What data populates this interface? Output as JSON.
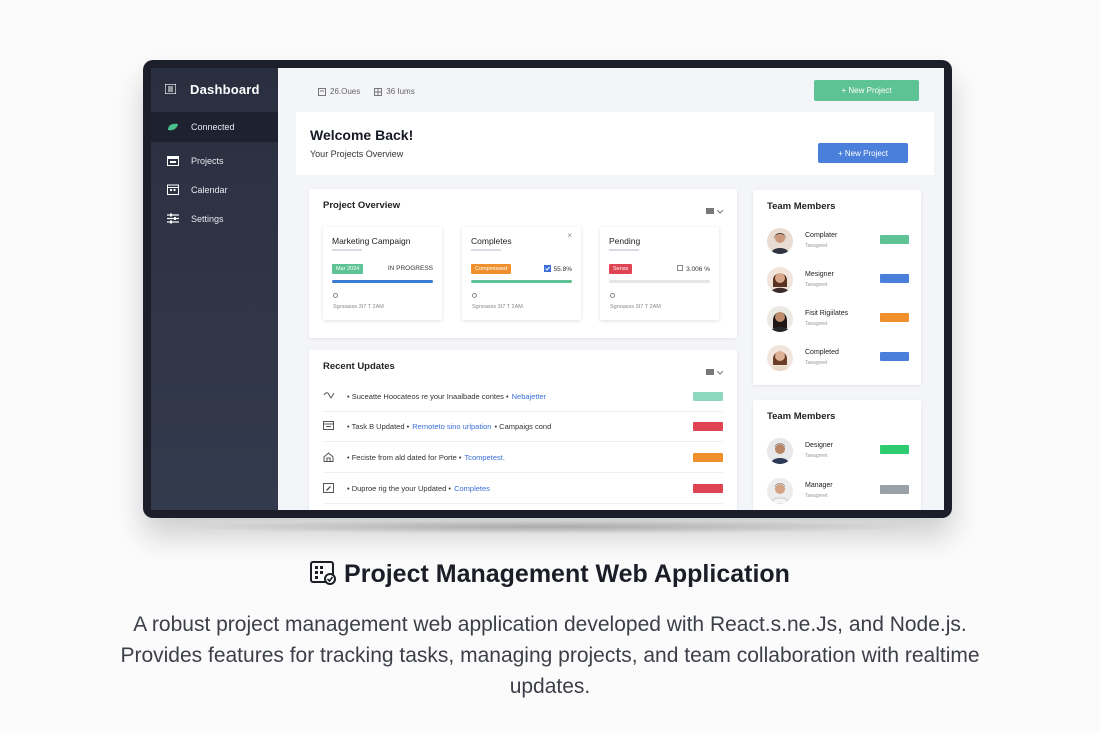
{
  "sidebar": {
    "title": "Dashboard",
    "items": [
      {
        "label": "Connected",
        "icon": "leaf-icon",
        "active": true
      },
      {
        "label": "Projects",
        "icon": "folder-icon"
      },
      {
        "label": "Calendar",
        "icon": "calendar-icon"
      },
      {
        "label": "Settings",
        "icon": "sliders-icon"
      }
    ]
  },
  "topbar": {
    "tabs": [
      "26.Oues",
      "36 Iums"
    ],
    "new_project_label": "+ New Project"
  },
  "welcome": {
    "title": "Welcome Back!",
    "subtitle": "Your Projects Overview",
    "new_project_label": "+ New Project"
  },
  "overview": {
    "title": "Project Overview",
    "cards": [
      {
        "title": "Marketing Campaign",
        "badge": "Mar 2024",
        "badge_color": "#5ec394",
        "stat": "IN PROGRESS",
        "progress": 1.0,
        "bar_color": "#3a7bd5",
        "footer": "Sgnoasss 3I7 T 2AM"
      },
      {
        "title": "Completes",
        "badge": "Compmissed",
        "badge_color": "#f0902c",
        "stat": "55.8%",
        "progress": 1.0,
        "bar_color": "#5ec394",
        "footer": "Sgnoasss 3I7 T 2AM"
      },
      {
        "title": "Pending",
        "badge": "Senss",
        "badge_color": "#de4453",
        "stat": "3.006 %",
        "progress": 0.0,
        "bar_color": "#e4e6ea",
        "footer": "Sgnoasss 3I7 T 2AM"
      }
    ]
  },
  "updates": {
    "title": "Recent Updates",
    "rows": [
      {
        "pre": "• Suceatte Hoocateos re your Inaalbade contes •",
        "link": "Nebajetter",
        "post": "",
        "icon": "check-icon",
        "tag_color": "#8fd8c0"
      },
      {
        "pre": "• Task B Updated •",
        "link": "Remoteto sino urlpation",
        "post": "• Campaigs cond",
        "icon": "inbox-icon",
        "tag_color": "#de4453"
      },
      {
        "pre": "• Feciste from ald dated for Porte •",
        "link": "Tcompetest.",
        "post": "",
        "icon": "home-icon",
        "tag_color": "#f0902c"
      },
      {
        "pre": "• Duproe rig the your Updated •",
        "link": "Completes",
        "post": "",
        "icon": "edit-icon",
        "tag_color": "#de4453"
      }
    ]
  },
  "team1": {
    "title": "Team Members",
    "members": [
      {
        "name": "Complater",
        "sub": "Taeagreet",
        "tag_color": "#5ec394"
      },
      {
        "name": "Mesigner",
        "sub": "Taeagreet",
        "tag_color": "#4a7fdc"
      },
      {
        "name": "Fisit Rigiilates",
        "sub": "Taeagreet",
        "tag_color": "#f0902c"
      },
      {
        "name": "Completed",
        "sub": "Taeagreet",
        "tag_color": "#4a7fdc"
      }
    ]
  },
  "team2": {
    "title": "Team Members",
    "members": [
      {
        "name": "Designer",
        "sub": "Taeagreet",
        "tag_color": "#2ecc71"
      },
      {
        "name": "Manager",
        "sub": "Taeagreet",
        "tag_color": "#9aa0a8"
      }
    ]
  },
  "caption": {
    "title": "Project Management Web Application",
    "description": "A robust project management web application developed with React.s.ne.Js, and Node.js. Provides features for tracking tasks, managing projects, and team collaboration with realtime updates."
  }
}
